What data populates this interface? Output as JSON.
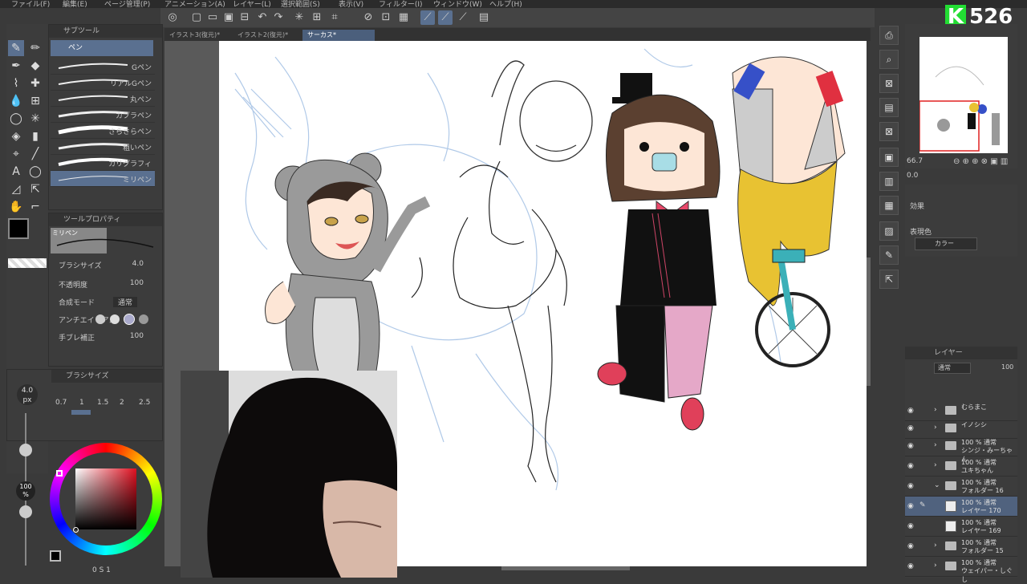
{
  "menu": [
    "ファイル(F)",
    "編集(E)",
    "ページ管理(P)",
    "アニメーション(A)",
    "レイヤー(L)",
    "選択範囲(S)",
    "表示(V)",
    "フィルター(I)",
    "ウィンドウ(W)",
    "ヘルプ(H)"
  ],
  "tabs": [
    {
      "label": "イラスト3(復元)*"
    },
    {
      "label": "イラスト2(復元)*"
    },
    {
      "label": "サーカス*"
    }
  ],
  "subtool": {
    "header": "サブツール",
    "current": "ペン",
    "brushes": [
      "Gペン",
      "リアルGペン",
      "丸ペン",
      "カブラペン",
      "さらさらペン",
      "粗いペン",
      "カリグラフィ",
      "ミリペン"
    ]
  },
  "tool_property": {
    "header": "ツールプロパティ",
    "preview_label": "ミリペン",
    "rows": [
      {
        "name": "ブラシサイズ",
        "value": "4.0"
      },
      {
        "name": "不透明度",
        "value": "100"
      },
      {
        "name": "合成モード",
        "value": "通常"
      },
      {
        "name": "アンチエイリアス",
        "value": ""
      },
      {
        "name": "手ブレ補正",
        "value": "100"
      }
    ]
  },
  "brush_size": {
    "header": "ブラシサイズ",
    "current": "4.0",
    "unit": "px",
    "presets": [
      "0.7",
      "1",
      "1.5",
      "2",
      "2.5"
    ]
  },
  "color": {
    "opacity": "100",
    "opacity_unit": "%",
    "main_color": "#000000"
  },
  "navigator": {
    "zoom": "66.7",
    "angle": "0.0"
  },
  "effect": {
    "label": "効果",
    "expression_label": "表現色",
    "expression_value": "カラー"
  },
  "layer_panel": {
    "header": "レイヤー",
    "blend": "通常",
    "opacity": "100",
    "layers": [
      {
        "l1": "むらまこ",
        "l2": "",
        "type": "folder"
      },
      {
        "l1": "イノシシ",
        "l2": "",
        "type": "folder"
      },
      {
        "l1": "100 % 通常",
        "l2": "シンジ・みーちゃん",
        "type": "folder"
      },
      {
        "l1": "100 % 通常",
        "l2": "ユキちゃん",
        "type": "folder"
      },
      {
        "l1": "100 % 通常",
        "l2": "フォルダー 16",
        "type": "folder-open"
      },
      {
        "l1": "100 % 通常",
        "l2": "レイヤー 170",
        "type": "layer",
        "selected": true
      },
      {
        "l1": "100 % 通常",
        "l2": "レイヤー 169",
        "type": "layer"
      },
      {
        "l1": "100 % 通常",
        "l2": "フォルダー 15",
        "type": "folder"
      },
      {
        "l1": "100 % 通常",
        "l2": "ウェイパー・しぐし",
        "type": "folder"
      }
    ]
  },
  "logo": {
    "text": "526"
  },
  "status": {
    "text": "0 S 1"
  },
  "colors": {
    "accent": "#5a7090",
    "logo_green": "#22dd33"
  }
}
